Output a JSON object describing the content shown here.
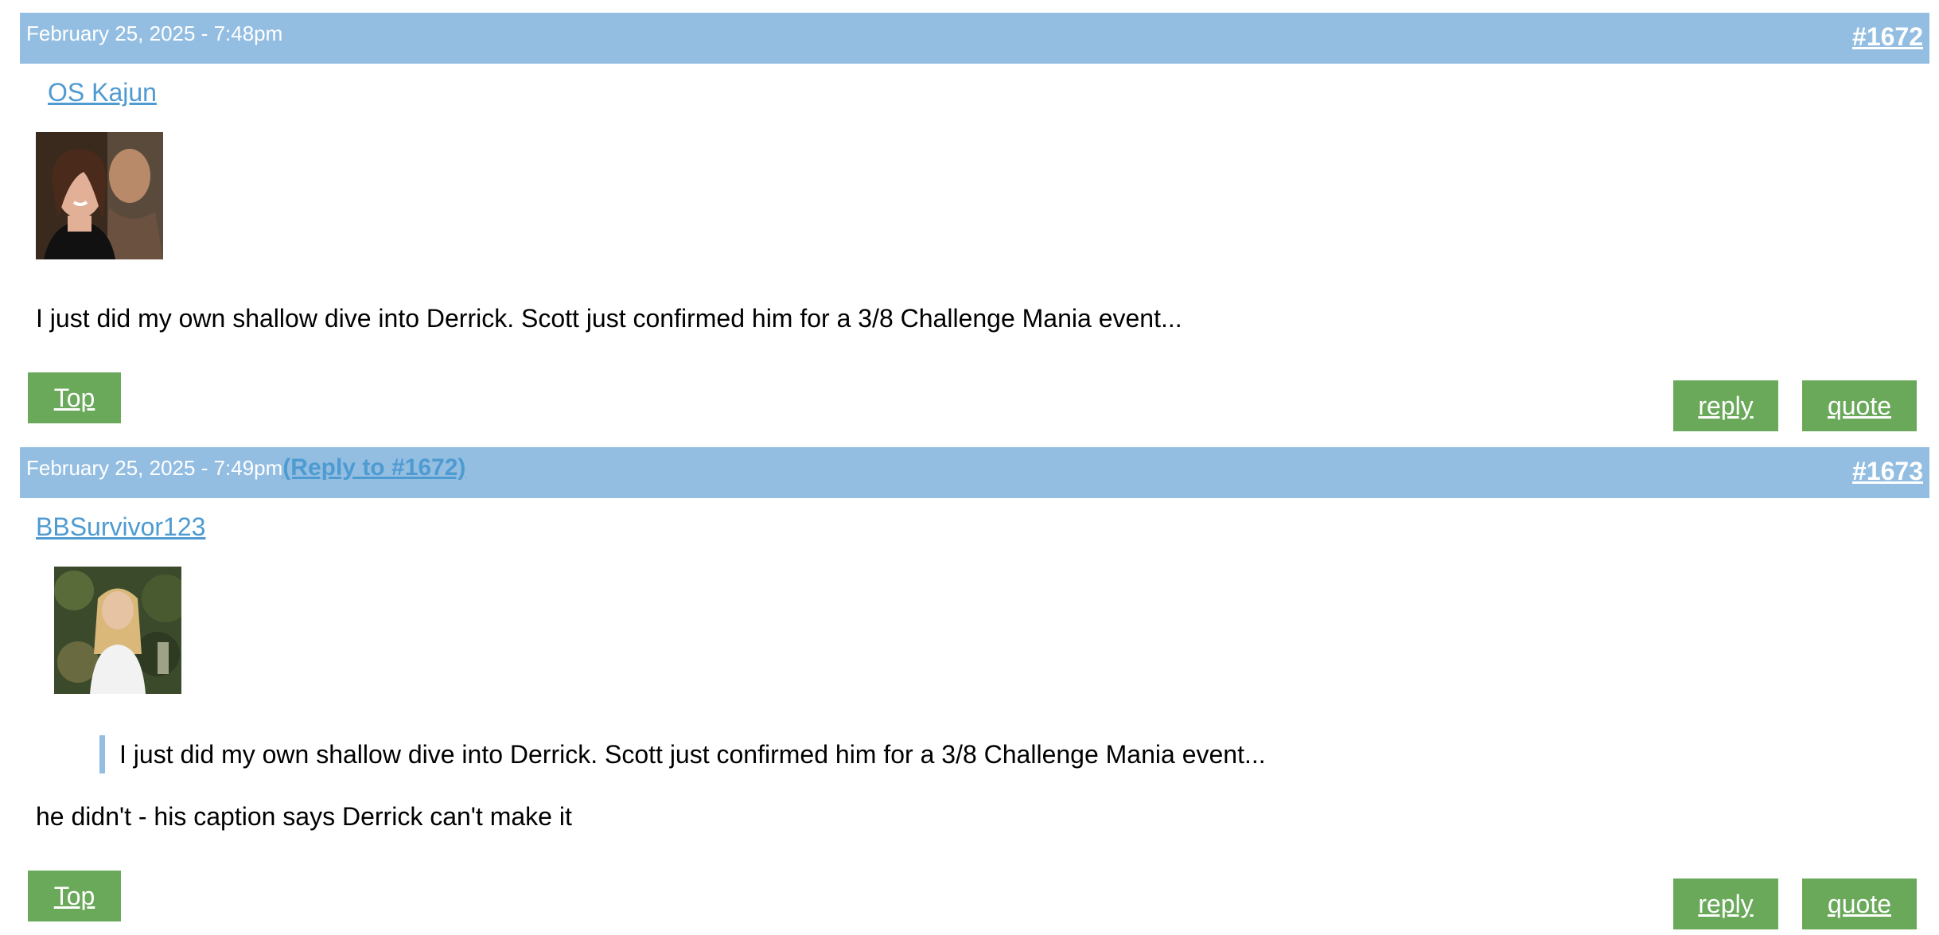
{
  "posts": [
    {
      "date": "February 25, 2025 - 7:48pm",
      "reply_to": "",
      "number": "#1672",
      "username": "OS Kajun",
      "avatar_icon": "couple-photo-avatar",
      "quote": "",
      "body": "I just did my own shallow dive into Derrick. Scott just confirmed him for a 3/8 Challenge Mania event...",
      "top_label": "Top",
      "reply_label": "reply",
      "quote_label": "quote"
    },
    {
      "date": "February 25, 2025 - 7:49pm",
      "reply_to": "(Reply to #1672)",
      "number": "#1673",
      "username": "BBSurvivor123",
      "avatar_icon": "woman-photo-avatar",
      "quote": "I just did my own shallow dive into Derrick. Scott just confirmed him for a 3/8 Challenge Mania event...",
      "body": "he didn't - his caption says Derrick can't make it",
      "top_label": "Top",
      "reply_label": "reply",
      "quote_label": "quote"
    }
  ],
  "colors": {
    "header_bar": "#93bee2",
    "link": "#4e9bd1",
    "button": "#6aa85a"
  }
}
